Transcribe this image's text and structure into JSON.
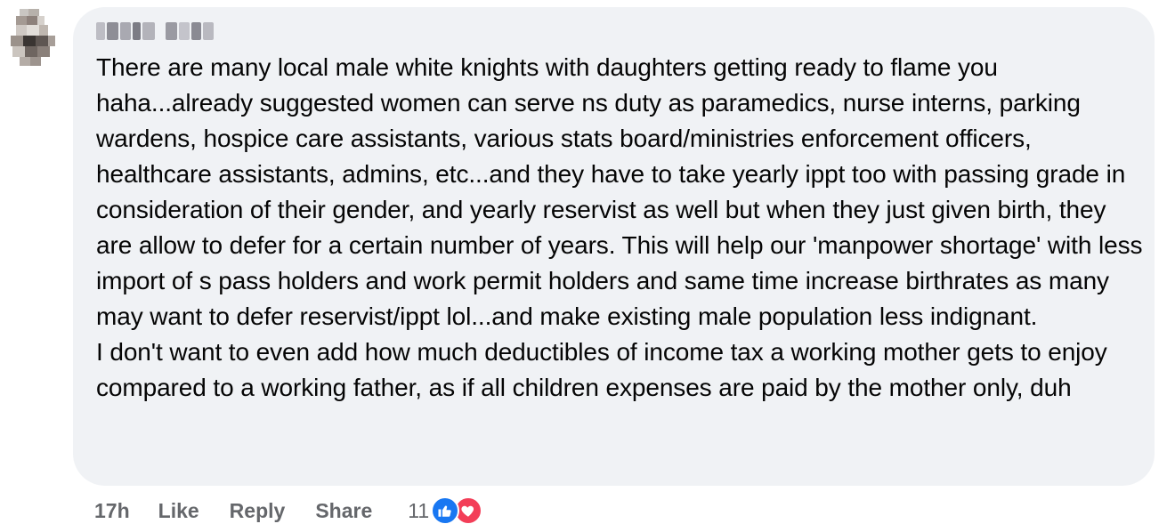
{
  "comment": {
    "author_name": "",
    "text": "There are many local male white knights with daughters getting ready to flame you haha...already suggested women can serve ns duty as paramedics, nurse interns, parking wardens, hospice care assistants, various stats board/ministries enforcement officers, healthcare assistants, admins, etc...and they have to take yearly ippt too with passing grade in consideration of their gender, and yearly reservist as well but when they just given birth, they are allow to defer for a certain number of years. This will help our 'manpower shortage' with less import of s pass holders and work permit holders and same time increase birthrates as many may want to defer reservist/ippt lol...and make existing male population less indignant.\nI don't want to even add how much deductibles of income tax a working mother gets to enjoy compared to a working father, as if all children expenses are paid by the mother only, duh"
  },
  "actions": {
    "timestamp": "17h",
    "like_label": "Like",
    "reply_label": "Reply",
    "share_label": "Share"
  },
  "reactions": {
    "count": "11",
    "types": [
      "like",
      "love"
    ]
  },
  "colors": {
    "bubble_bg": "#f0f2f5",
    "text": "#050505",
    "muted": "#65676b",
    "like_blue": "#1877f2",
    "love_red": "#f33e58"
  }
}
